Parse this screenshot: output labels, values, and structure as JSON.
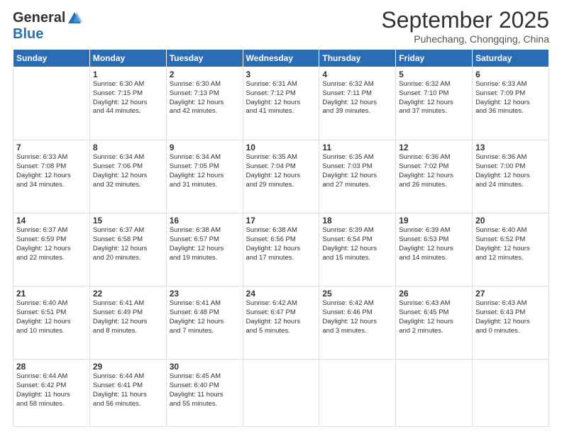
{
  "logo": {
    "general": "General",
    "blue": "Blue"
  },
  "header": {
    "month": "September 2025",
    "location": "Puhechang, Chongqing, China"
  },
  "days_of_week": [
    "Sunday",
    "Monday",
    "Tuesday",
    "Wednesday",
    "Thursday",
    "Friday",
    "Saturday"
  ],
  "weeks": [
    [
      {
        "day": "",
        "info": ""
      },
      {
        "day": "1",
        "info": "Sunrise: 6:30 AM\nSunset: 7:15 PM\nDaylight: 12 hours\nand 44 minutes."
      },
      {
        "day": "2",
        "info": "Sunrise: 6:30 AM\nSunset: 7:13 PM\nDaylight: 12 hours\nand 42 minutes."
      },
      {
        "day": "3",
        "info": "Sunrise: 6:31 AM\nSunset: 7:12 PM\nDaylight: 12 hours\nand 41 minutes."
      },
      {
        "day": "4",
        "info": "Sunrise: 6:32 AM\nSunset: 7:11 PM\nDaylight: 12 hours\nand 39 minutes."
      },
      {
        "day": "5",
        "info": "Sunrise: 6:32 AM\nSunset: 7:10 PM\nDaylight: 12 hours\nand 37 minutes."
      },
      {
        "day": "6",
        "info": "Sunrise: 6:33 AM\nSunset: 7:09 PM\nDaylight: 12 hours\nand 36 minutes."
      }
    ],
    [
      {
        "day": "7",
        "info": "Sunrise: 6:33 AM\nSunset: 7:08 PM\nDaylight: 12 hours\nand 34 minutes."
      },
      {
        "day": "8",
        "info": "Sunrise: 6:34 AM\nSunset: 7:06 PM\nDaylight: 12 hours\nand 32 minutes."
      },
      {
        "day": "9",
        "info": "Sunrise: 6:34 AM\nSunset: 7:05 PM\nDaylight: 12 hours\nand 31 minutes."
      },
      {
        "day": "10",
        "info": "Sunrise: 6:35 AM\nSunset: 7:04 PM\nDaylight: 12 hours\nand 29 minutes."
      },
      {
        "day": "11",
        "info": "Sunrise: 6:35 AM\nSunset: 7:03 PM\nDaylight: 12 hours\nand 27 minutes."
      },
      {
        "day": "12",
        "info": "Sunrise: 6:36 AM\nSunset: 7:02 PM\nDaylight: 12 hours\nand 26 minutes."
      },
      {
        "day": "13",
        "info": "Sunrise: 6:36 AM\nSunset: 7:00 PM\nDaylight: 12 hours\nand 24 minutes."
      }
    ],
    [
      {
        "day": "14",
        "info": "Sunrise: 6:37 AM\nSunset: 6:59 PM\nDaylight: 12 hours\nand 22 minutes."
      },
      {
        "day": "15",
        "info": "Sunrise: 6:37 AM\nSunset: 6:58 PM\nDaylight: 12 hours\nand 20 minutes."
      },
      {
        "day": "16",
        "info": "Sunrise: 6:38 AM\nSunset: 6:57 PM\nDaylight: 12 hours\nand 19 minutes."
      },
      {
        "day": "17",
        "info": "Sunrise: 6:38 AM\nSunset: 6:56 PM\nDaylight: 12 hours\nand 17 minutes."
      },
      {
        "day": "18",
        "info": "Sunrise: 6:39 AM\nSunset: 6:54 PM\nDaylight: 12 hours\nand 15 minutes."
      },
      {
        "day": "19",
        "info": "Sunrise: 6:39 AM\nSunset: 6:53 PM\nDaylight: 12 hours\nand 14 minutes."
      },
      {
        "day": "20",
        "info": "Sunrise: 6:40 AM\nSunset: 6:52 PM\nDaylight: 12 hours\nand 12 minutes."
      }
    ],
    [
      {
        "day": "21",
        "info": "Sunrise: 6:40 AM\nSunset: 6:51 PM\nDaylight: 12 hours\nand 10 minutes."
      },
      {
        "day": "22",
        "info": "Sunrise: 6:41 AM\nSunset: 6:49 PM\nDaylight: 12 hours\nand 8 minutes."
      },
      {
        "day": "23",
        "info": "Sunrise: 6:41 AM\nSunset: 6:48 PM\nDaylight: 12 hours\nand 7 minutes."
      },
      {
        "day": "24",
        "info": "Sunrise: 6:42 AM\nSunset: 6:47 PM\nDaylight: 12 hours\nand 5 minutes."
      },
      {
        "day": "25",
        "info": "Sunrise: 6:42 AM\nSunset: 6:46 PM\nDaylight: 12 hours\nand 3 minutes."
      },
      {
        "day": "26",
        "info": "Sunrise: 6:43 AM\nSunset: 6:45 PM\nDaylight: 12 hours\nand 2 minutes."
      },
      {
        "day": "27",
        "info": "Sunrise: 6:43 AM\nSunset: 6:43 PM\nDaylight: 12 hours\nand 0 minutes."
      }
    ],
    [
      {
        "day": "28",
        "info": "Sunrise: 6:44 AM\nSunset: 6:42 PM\nDaylight: 11 hours\nand 58 minutes."
      },
      {
        "day": "29",
        "info": "Sunrise: 6:44 AM\nSunset: 6:41 PM\nDaylight: 11 hours\nand 56 minutes."
      },
      {
        "day": "30",
        "info": "Sunrise: 6:45 AM\nSunset: 6:40 PM\nDaylight: 11 hours\nand 55 minutes."
      },
      {
        "day": "",
        "info": ""
      },
      {
        "day": "",
        "info": ""
      },
      {
        "day": "",
        "info": ""
      },
      {
        "day": "",
        "info": ""
      }
    ]
  ]
}
